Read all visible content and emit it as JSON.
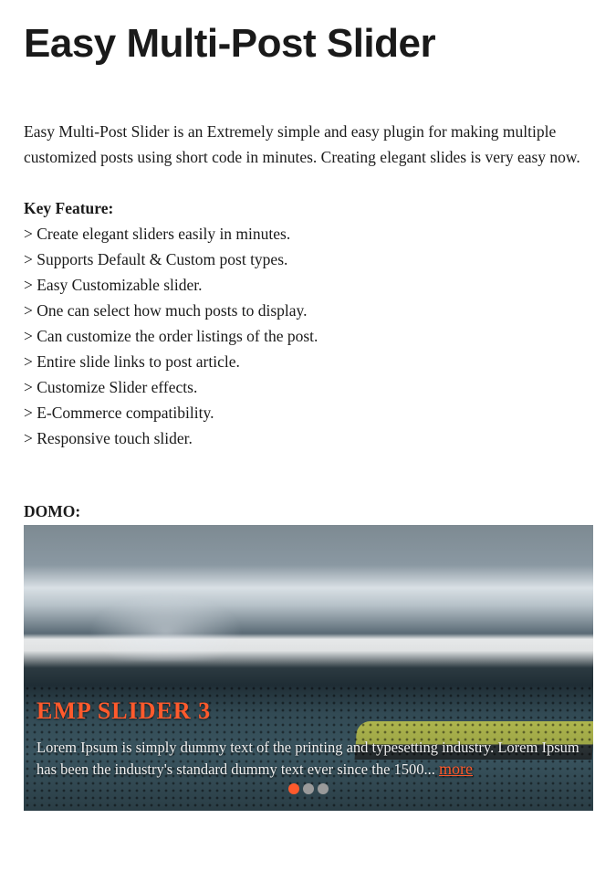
{
  "page_title": "Easy Multi-Post Slider",
  "intro": "Easy Multi-Post Slider is an Extremely simple and easy plugin for making multiple customized posts using short code in minutes. Creating elegant slides is very easy now.",
  "key_feature_label": "Key Feature:",
  "features": [
    "> Create elegant sliders easily in minutes.",
    "> Supports Default & Custom post types.",
    "> Easy Customizable slider.",
    "> One can select how much posts to display.",
    "> Can customize the order listings of the post.",
    "> Entire slide links to post article.",
    "> Customize Slider effects.",
    "> E-Commerce compatibility.",
    "> Responsive touch slider."
  ],
  "demo_label": "DOMO:",
  "slide": {
    "title": "EMP SLIDER 3",
    "desc": "Lorem Ipsum is simply dummy text of the printing and typesetting industry. Lorem Ipsum has been the industry's standard dummy text ever since the 1500... ",
    "more": "more"
  },
  "dots": {
    "count": 3,
    "active_index": 0
  },
  "colors": {
    "accent": "#ff5a2c"
  }
}
